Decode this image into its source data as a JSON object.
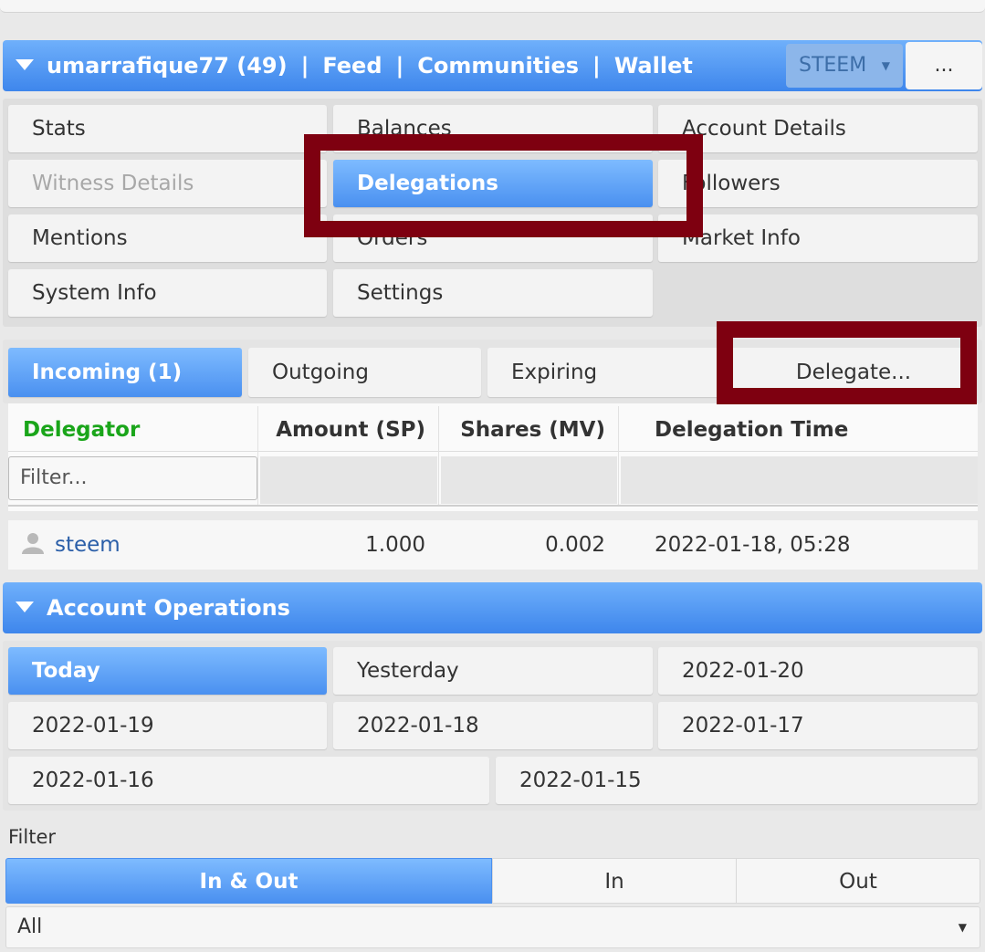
{
  "header": {
    "account": "umarrafique77 (49)",
    "separator": "|",
    "links": [
      "Feed",
      "Communities",
      "Wallet"
    ],
    "currency": "STEEM",
    "more": "..."
  },
  "menu": {
    "stats": "Stats",
    "balances": "Balances",
    "account_details": "Account Details",
    "witness_details": "Witness Details",
    "delegations": "Delegations",
    "followers": "Followers",
    "mentions": "Mentions",
    "orders": "Orders",
    "market_info": "Market Info",
    "system_info": "System Info",
    "settings": "Settings"
  },
  "delegation_tabs": {
    "incoming": "Incoming (1)",
    "outgoing": "Outgoing",
    "expiring": "Expiring",
    "delegate": "Delegate..."
  },
  "table": {
    "headers": [
      "Delegator",
      "Amount (SP)",
      "Shares (MV)",
      "Delegation Time"
    ],
    "filter_placeholder": "Filter...",
    "rows": [
      {
        "delegator": "steem",
        "amount": "1.000",
        "shares": "0.002",
        "time": "2022-01-18, 05:28"
      }
    ]
  },
  "account_operations": {
    "title": "Account Operations",
    "dates": [
      "Today",
      "Yesterday",
      "2022-01-20",
      "2022-01-19",
      "2022-01-18",
      "2022-01-17",
      "2022-01-16",
      "2022-01-15"
    ],
    "filter_label": "Filter",
    "direction": [
      "In & Out",
      "In",
      "Out"
    ],
    "type_selected": "All"
  },
  "colors": {
    "accent_blue": "#4a90f0",
    "highlight_box": "#7e0010",
    "delegator_header": "#1aa51a",
    "link": "#2a5ea8"
  }
}
